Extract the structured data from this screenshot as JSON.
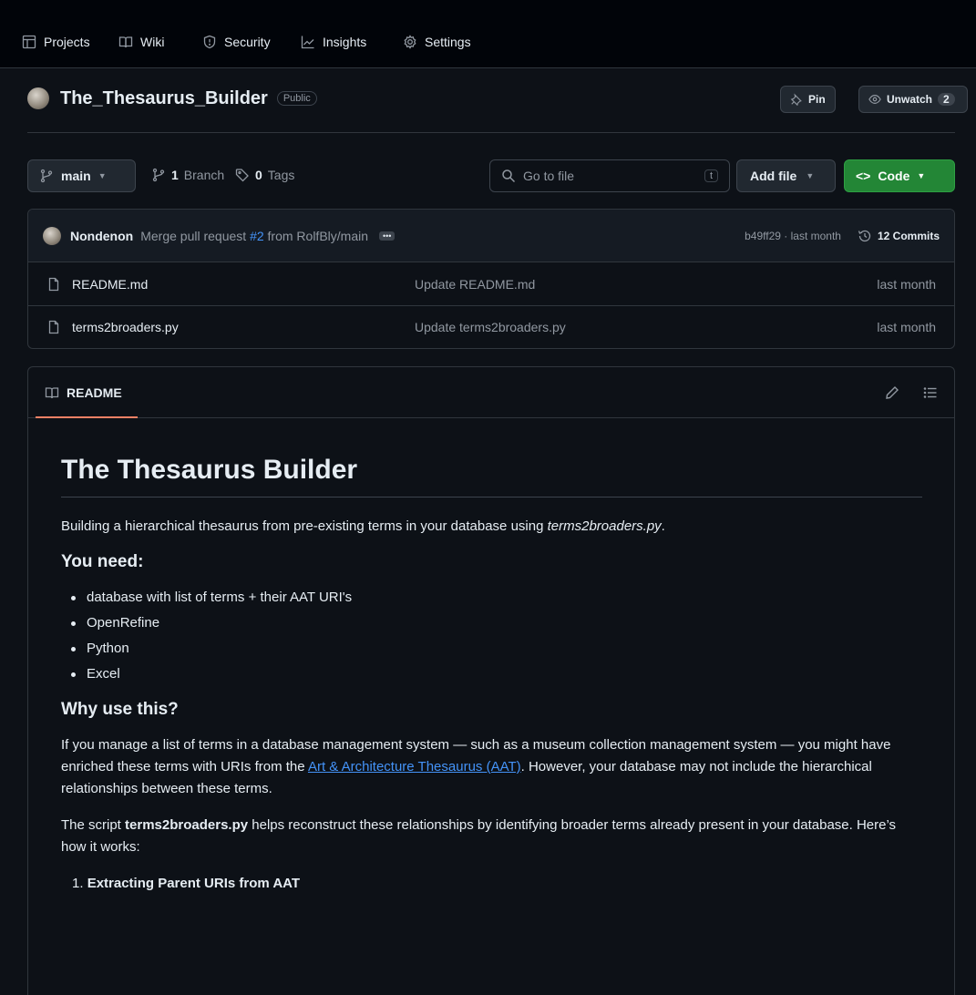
{
  "nav": {
    "items": [
      {
        "label": "Projects",
        "icon": "table-icon"
      },
      {
        "label": "Wiki",
        "icon": "book-icon"
      },
      {
        "label": "Security",
        "icon": "shield-icon"
      },
      {
        "label": "Insights",
        "icon": "graph-icon"
      },
      {
        "label": "Settings",
        "icon": "gear-icon"
      }
    ]
  },
  "repo": {
    "name": "The_Thesaurus_Builder",
    "visibility": "Public",
    "pin_label": "Pin",
    "unwatch_label": "Unwatch",
    "watch_count": "2"
  },
  "toolbar": {
    "branch": "main",
    "branch_count": "1",
    "branch_label": "Branch",
    "tag_count": "0",
    "tag_label": "Tags",
    "search_placeholder": "Go to file",
    "search_key": "t",
    "add_file_label": "Add file",
    "code_label": "Code"
  },
  "commit": {
    "author": "Nondenon",
    "message_prefix": "Merge pull request",
    "pr_link": "#2",
    "message_suffix": "from RolfBly/main",
    "hash_time": "b49ff29 · last month",
    "commits_label": "12 Commits"
  },
  "files": [
    {
      "name": "README.md",
      "message": "Update README.md",
      "date": "last month"
    },
    {
      "name": "terms2broaders.py",
      "message": "Update terms2broaders.py",
      "date": "last month"
    }
  ],
  "readme": {
    "tab_label": "README",
    "title": "The Thesaurus Builder",
    "intro_text": "Building a hierarchical thesaurus from pre-existing terms in your database using ",
    "intro_script": "terms2broaders.py",
    "intro_end": ".",
    "need_heading": "You need:",
    "needs": [
      "database with list of terms + their AAT URI's",
      "OpenRefine",
      "Python",
      "Excel"
    ],
    "why_heading": "Why use this?",
    "why_p1_a": "If you manage a list of terms in a database management system — such as a museum collection management system — you might have enriched these terms with URIs from the ",
    "why_p1_link": "Art & Architecture Thesaurus (AAT)",
    "why_p1_b": ". However, your database may not include the hierarchical relationships between these terms.",
    "why_p2_a": "The script ",
    "why_p2_bold": "terms2broaders.py",
    "why_p2_b": " helps reconstruct these relationships by identifying broader terms already present in your database. Here’s how it works:",
    "steps": [
      "Extracting Parent URIs from AAT"
    ]
  }
}
